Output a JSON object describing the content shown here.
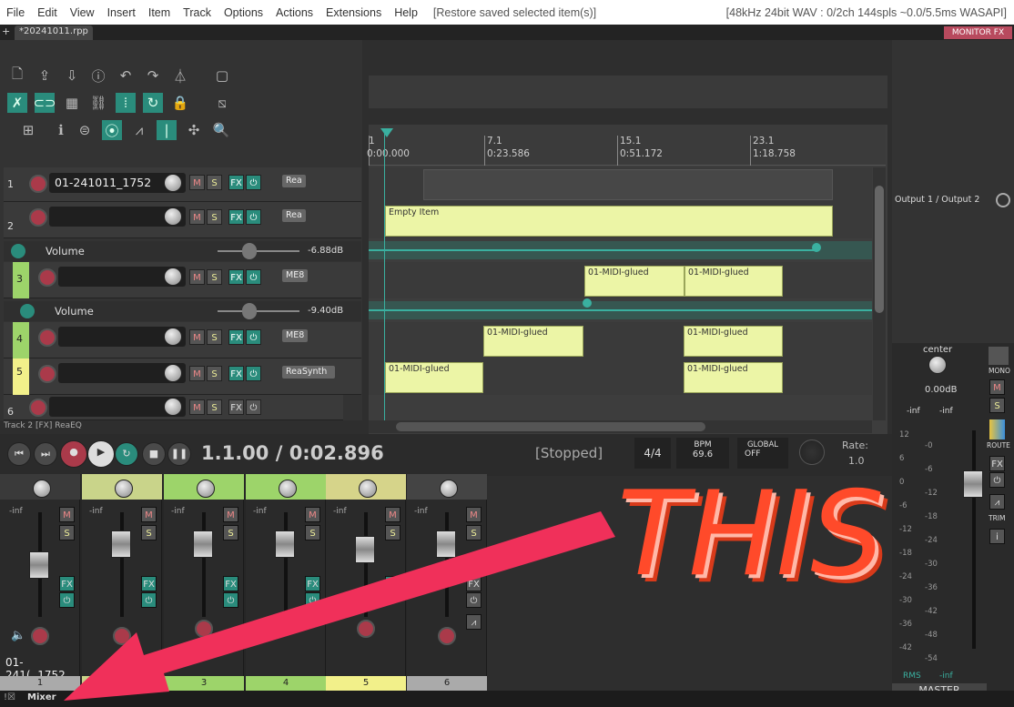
{
  "menu": {
    "items": [
      "File",
      "Edit",
      "View",
      "Insert",
      "Item",
      "Track",
      "Options",
      "Actions",
      "Extensions",
      "Help"
    ],
    "status": "[Restore saved selected item(s)]",
    "audio_info": "[48kHz 24bit WAV : 0/2ch 144spls ~0.0/5.5ms WASAPI]"
  },
  "tabs": {
    "plus": "+",
    "project": "*20241011.rpp",
    "monitor_fx": "MONITOR FX"
  },
  "ruler": {
    "markers": [
      {
        "bar": "1",
        "time": "0:00.000"
      },
      {
        "bar": "7.1",
        "time": "0:23.586"
      },
      {
        "bar": "15.1",
        "time": "0:51.172"
      },
      {
        "bar": "23.1",
        "time": "1:18.758"
      }
    ]
  },
  "tracks": [
    {
      "num": "1",
      "name": "01-241011_1752",
      "fx": "Rea"
    },
    {
      "num": "2",
      "name": "",
      "fx": "Rea"
    },
    {
      "num": "3",
      "name": "",
      "fx": "ME8"
    },
    {
      "num": "4",
      "name": "",
      "fx": "ME8"
    },
    {
      "num": "5",
      "name": "",
      "fx": "ReaSynth"
    },
    {
      "num": "6",
      "name": "",
      "fx": ""
    }
  ],
  "envelopes": [
    {
      "label": "Volume",
      "value": "-6.88dB"
    },
    {
      "label": "Volume",
      "value": "-9.40dB"
    }
  ],
  "buttons": {
    "mute": "M",
    "solo": "S",
    "fx": "FX"
  },
  "items": {
    "empty": "Empty Item",
    "midi": "01-MIDI-glued"
  },
  "status_line": "Track 2 [FX] ReaEQ",
  "transport": {
    "position": "1.1.00 / 0:02.896",
    "state": "[Stopped]",
    "time_sig": "4/4",
    "bpm_label": "BPM",
    "bpm": "69.6",
    "global_label": "GLOBAL",
    "global_value": "OFF",
    "rate_label": "Rate:",
    "rate": "1.0"
  },
  "io": {
    "output": "Output 1 / Output 2"
  },
  "mixer": {
    "strips": [
      {
        "num": "1",
        "label": "01-241(..1752",
        "peak": "-inf",
        "color": "#aaaaaa"
      },
      {
        "num": "2",
        "label": "",
        "peak": "-inf",
        "color": "#c9d48a"
      },
      {
        "num": "3",
        "label": "",
        "peak": "-inf",
        "color": "#9dd46a"
      },
      {
        "num": "4",
        "label": "",
        "peak": "-inf",
        "color": "#9dd46a"
      },
      {
        "num": "5",
        "label": "",
        "peak": "-inf",
        "color": "#f2f08a"
      },
      {
        "num": "6",
        "label": "",
        "peak": "-inf",
        "color": "#aaaaaa"
      }
    ],
    "title": "Mixer"
  },
  "master": {
    "pan": "center",
    "volume": "0.00dB",
    "peak_l": "-inf",
    "peak_r": "-inf",
    "scale": [
      "12",
      "6",
      "0",
      "-6",
      "-12",
      "-18",
      "-24",
      "-30",
      "-36",
      "-42",
      "-48",
      "-54"
    ],
    "scale_r": [
      "-0",
      "-6",
      "-12",
      "-18",
      "-24",
      "-30",
      "-36",
      "-42",
      "-48",
      "-54"
    ],
    "rms_label": "RMS",
    "rms_value": "-inf",
    "name": "MASTER",
    "mono": "MONO",
    "route": "ROUTE",
    "trim": "TRIM"
  },
  "annotation": {
    "text": "THIS"
  },
  "colors": {
    "accent": "#2a8c7c",
    "annotation": "#ff4a2a"
  }
}
